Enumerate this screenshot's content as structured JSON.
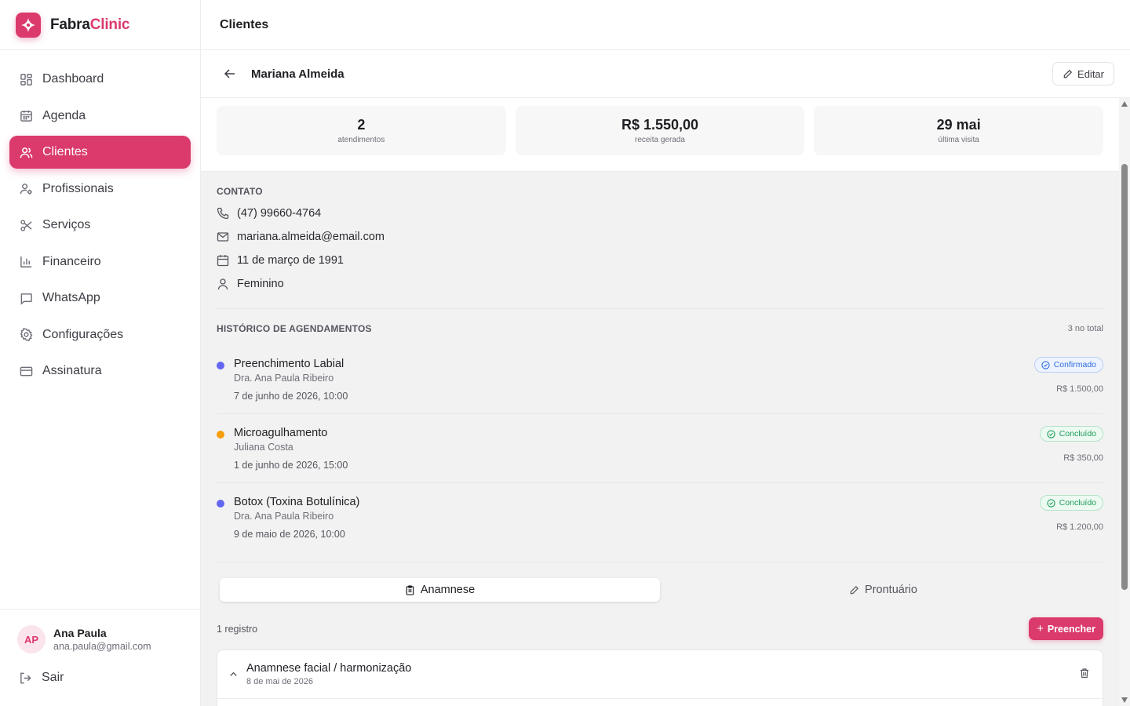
{
  "brand": {
    "name_part1": "Fabra",
    "name_part2": "Clinic",
    "color": "#db3a6c"
  },
  "sidebar": {
    "items": [
      {
        "label": "Dashboard",
        "icon": "dashboard-icon"
      },
      {
        "label": "Agenda",
        "icon": "calendar-icon"
      },
      {
        "label": "Clientes",
        "icon": "users-icon",
        "active": true
      },
      {
        "label": "Profissionais",
        "icon": "user-cog-icon"
      },
      {
        "label": "Serviços",
        "icon": "scissors-icon"
      },
      {
        "label": "Financeiro",
        "icon": "bar-chart-icon"
      },
      {
        "label": "WhatsApp",
        "icon": "chat-icon"
      },
      {
        "label": "Configurações",
        "icon": "gear-icon"
      },
      {
        "label": "Assinatura",
        "icon": "credit-card-icon"
      }
    ]
  },
  "user": {
    "initials": "AP",
    "name": "Ana Paula",
    "email": "ana.paula@gmail.com",
    "logout_label": "Sair"
  },
  "header": {
    "title": "Clientes"
  },
  "client": {
    "name": "Mariana Almeida",
    "edit_label": "Editar"
  },
  "stats": [
    {
      "value": "2",
      "label": "atendimentos"
    },
    {
      "value": "R$ 1.550,00",
      "label": "receita gerada"
    },
    {
      "value": "29 mai",
      "label": "última visita"
    }
  ],
  "contact": {
    "title": "CONTATO",
    "phone": "(47) 99660-4764",
    "email": "mariana.almeida@email.com",
    "birthdate": "11 de março de 1991",
    "gender": "Feminino"
  },
  "history": {
    "title": "HISTÓRICO DE AGENDAMENTOS",
    "count": "3 no total",
    "items": [
      {
        "service": "Preenchimento Labial",
        "professional": "Dra. Ana Paula Ribeiro",
        "date": "7 de junho de 2026, 10:00",
        "status": "Confirmado",
        "status_type": "confirmed",
        "price": "R$ 1.500,00",
        "dot_color": "#6366f1"
      },
      {
        "service": "Microagulhamento",
        "professional": "Juliana Costa",
        "date": "1 de junho de 2026, 15:00",
        "status": "Concluído",
        "status_type": "done",
        "price": "R$ 350,00",
        "dot_color": "#f59e0b"
      },
      {
        "service": "Botox (Toxina Botulínica)",
        "professional": "Dra. Ana Paula Ribeiro",
        "date": "9 de maio de 2026, 10:00",
        "status": "Concluído",
        "status_type": "done",
        "price": "R$ 1.200,00",
        "dot_color": "#6366f1"
      }
    ]
  },
  "tabs": [
    {
      "label": "Anamnese",
      "icon": "clipboard-icon",
      "active": true
    },
    {
      "label": "Prontuário",
      "icon": "pencil-icon",
      "active": false
    }
  ],
  "records": {
    "count": "1 registro",
    "fill_label": "Preencher",
    "items": [
      {
        "title": "Anamnese facial / harmonização",
        "date": "8 de mai de 2026"
      }
    ]
  }
}
